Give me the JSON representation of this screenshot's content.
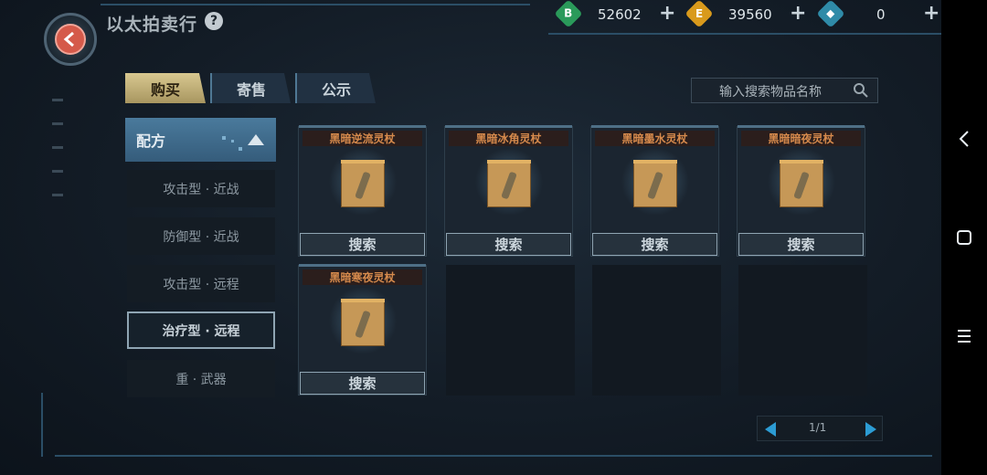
{
  "header": {
    "title": "以太拍卖行",
    "help_icon": "?"
  },
  "currencies": [
    {
      "icon": "B",
      "value": "52602",
      "color": "#2a9a5a"
    },
    {
      "icon": "E",
      "value": "39560",
      "color": "#d99a1c"
    },
    {
      "icon": "gem",
      "value": "0",
      "color": "#2f8ba8"
    }
  ],
  "tabs": [
    {
      "label": "购买",
      "active": true
    },
    {
      "label": "寄售",
      "active": false
    },
    {
      "label": "公示",
      "active": false
    }
  ],
  "search": {
    "placeholder": "输入搜索物品名称"
  },
  "category": {
    "header": "配方",
    "items": [
      {
        "label": "攻击型 · 近战",
        "selected": false
      },
      {
        "label": "防御型 · 近战",
        "selected": false
      },
      {
        "label": "攻击型 · 远程",
        "selected": false
      },
      {
        "label": "治疗型 · 远程",
        "selected": true
      },
      {
        "label": "重 · 武器",
        "selected": false
      }
    ]
  },
  "items": [
    {
      "name": "黑暗逆流灵杖",
      "button": "搜索"
    },
    {
      "name": "黑暗冰角灵杖",
      "button": "搜索"
    },
    {
      "name": "黑暗墨水灵杖",
      "button": "搜索"
    },
    {
      "name": "黑暗暗夜灵杖",
      "button": "搜索"
    },
    {
      "name": "黑暗寒夜灵杖",
      "button": "搜索"
    }
  ],
  "pagination": {
    "text": "1/1"
  },
  "colors": {
    "accent": "#2c9cd4",
    "tab_active": "#cbb97f",
    "item_title": "#d68a4c"
  }
}
